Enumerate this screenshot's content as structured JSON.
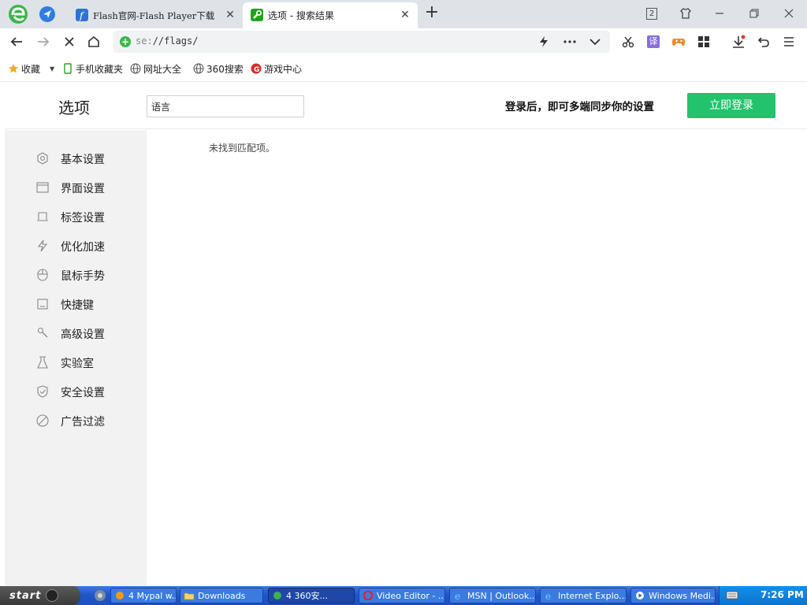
{
  "browser": {
    "tabs": [
      {
        "label": "Flash官网-Flash Player下载",
        "icon": "flash-icon",
        "active": false
      },
      {
        "label": "选项 - 搜索结果",
        "icon": "wrench-icon",
        "active": true
      }
    ],
    "tab_count_badge": "2",
    "address": {
      "scheme": "se:",
      "rest": "//flags/"
    }
  },
  "bookmarks": {
    "favorites": "收藏",
    "items": [
      "手机收藏夹",
      "网址大全",
      "360搜索",
      "游戏中心"
    ]
  },
  "settings": {
    "title": "选项",
    "search_value": "语言",
    "sync_message": "登录后，即可多端同步你的设置",
    "login_button": "立即登录",
    "no_match": "未找到匹配项。",
    "nav": [
      {
        "label": "基本设置",
        "icon": "gear-icon"
      },
      {
        "label": "界面设置",
        "icon": "window-icon"
      },
      {
        "label": "标签设置",
        "icon": "tab-icon"
      },
      {
        "label": "优化加速",
        "icon": "lightning-icon"
      },
      {
        "label": "鼠标手势",
        "icon": "mouse-icon"
      },
      {
        "label": "快捷键",
        "icon": "keyboard-icon"
      },
      {
        "label": "高级设置",
        "icon": "wrench-icon"
      },
      {
        "label": "实验室",
        "icon": "flask-icon"
      },
      {
        "label": "安全设置",
        "icon": "shield-icon"
      },
      {
        "label": "广告过滤",
        "icon": "block-icon"
      }
    ]
  },
  "taskbar": {
    "start_label": "start",
    "tasks": [
      {
        "label": "4 Mypal w...",
        "icon": "mypal-icon"
      },
      {
        "label": "Downloads",
        "icon": "folder-icon"
      },
      {
        "label": "4 360安...",
        "icon": "360-browser-icon",
        "active": true
      },
      {
        "label": "Video Editor - ...",
        "icon": "opera-icon"
      },
      {
        "label": "MSN | Outlook...",
        "icon": "ie-icon"
      },
      {
        "label": "Internet Explo...",
        "icon": "ie-icon"
      },
      {
        "label": "Windows Medi...",
        "icon": "media-player-icon"
      }
    ],
    "clock": "7:26 PM"
  },
  "colors": {
    "accent_green": "#23c26c",
    "taskbar_blue": "#1f56c7"
  }
}
